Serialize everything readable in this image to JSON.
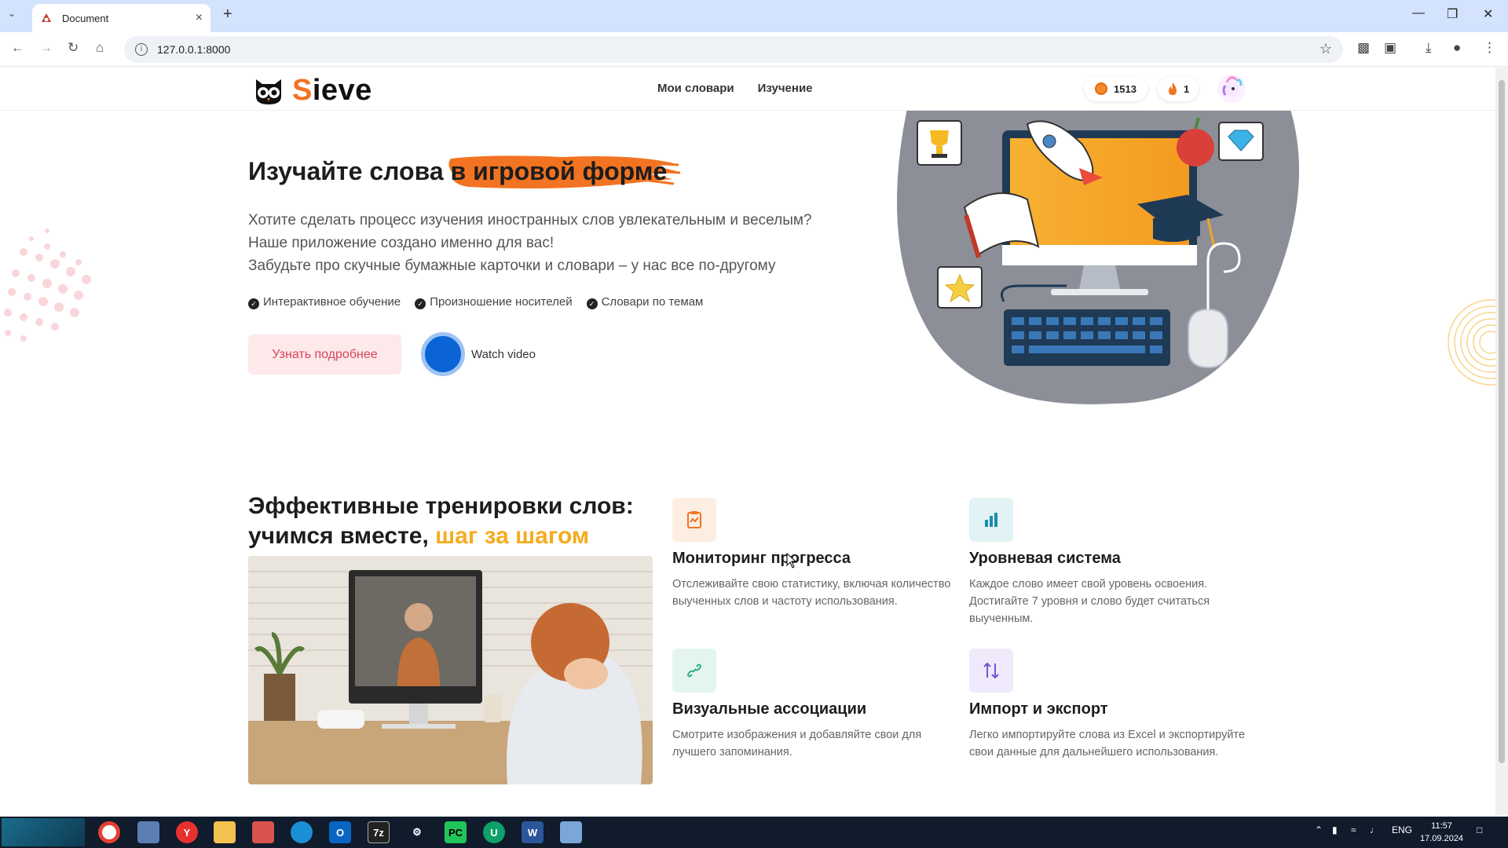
{
  "browser": {
    "tab_title": "Document",
    "url": "127.0.0.1:8000",
    "icons": [
      "tab-dropdown-icon",
      "close-icon",
      "new-tab-icon",
      "minimize-icon",
      "restore-icon",
      "window-close-icon",
      "back-icon",
      "forward-icon",
      "reload-icon",
      "home-icon",
      "info-icon",
      "star-icon",
      "extension-off-icon",
      "puzzle-icon",
      "download-icon",
      "profile-icon",
      "menu-icon"
    ]
  },
  "header": {
    "logo_first": "S",
    "logo_rest": "ieve",
    "menu": [
      "Мои словари",
      "Изучение"
    ],
    "coins": "1513",
    "streak": "1"
  },
  "hero": {
    "title_start": "Изучайте слова в ",
    "title_highlight": "игровой форме",
    "p1": "Хотите сделать процесс изучения иностранных слов увлекательным и веселым?",
    "p2": "Наше приложение создано именно для вас!",
    "p3": "Забудьте про скучные бумажные карточки и словари – у нас все по-другому",
    "features": [
      "Интерактивное обучение",
      "Произношение носителей",
      "Словари по темам"
    ],
    "btn_more": "Узнать подробнее",
    "watch": "Watch video"
  },
  "section2": {
    "title_line1": "Эффективные тренировки слов:",
    "title_line2_start": "учимся вместе, ",
    "title_line2_orange": "шаг за шагом",
    "cards": [
      {
        "title": "Мониторинг прогресса",
        "text": "Отслеживайте свою статистику, включая количество выученных слов и частоту использования.",
        "icon": "clipboard-chart-icon",
        "color": "#fdeee3"
      },
      {
        "title": "Уровневая система",
        "text": "Каждое слово имеет свой уровень освоения. Достигайте 7 уровня и слово будет считаться выученным.",
        "icon": "bar-chart-icon",
        "color": "#e2f3f5"
      },
      {
        "title": "Визуальные ассоциации",
        "text": "Смотрите изображения и добавляйте свои для лучшего запоминания.",
        "icon": "link-icon",
        "color": "#e3f5ee"
      },
      {
        "title": "Импорт и экспорт",
        "text": "Легко импортируйте слова из Excel и экспортируйте свои данные для дальнейшего использования.",
        "icon": "arrows-up-down-icon",
        "color": "#efe9fb"
      }
    ]
  },
  "taskbar": {
    "lang": "ENG",
    "time": "11:57",
    "date": "17.09.2024"
  }
}
